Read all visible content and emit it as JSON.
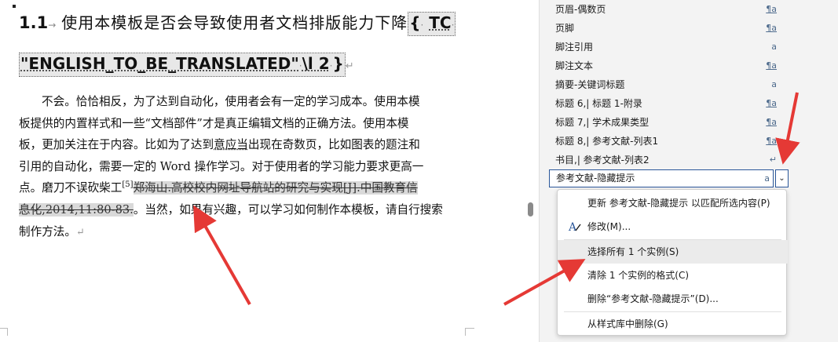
{
  "document": {
    "heading": {
      "number": "1.1",
      "title_cn": "使用本模板是否会导致使用者文档排版能力下降",
      "field_open": "{",
      "field_code": "TC",
      "field_arg": "\"ENGLISH_TO_BE_TRANSLATED\"",
      "field_switch": "\\l 2",
      "field_close": "}"
    },
    "paragraph": {
      "line1": "不会。恰恰相反，为了达到自动化，使用者会有一定的学习成本。使用本模",
      "line2": "板提供的内置样式和一些“文档部件”才是真正编辑文档的正确方法。使用本模",
      "line3_a": "板，更加关注在于内容。比如为了达到",
      "line3_u": "意应当",
      "line3_b": "出现在奇数页，比如图表的题注和",
      "line4": "引用的自动化，需要一定的 Word 操作学习。对于使用者的学习能力要求更高一",
      "line5_a": "点。磨刀不误砍柴工",
      "line5_sup": "[5]",
      "line5_strike": "郑海山.高校校内网址导航站的研究与实现[J].中国教育信",
      "line6_strike": "息化,2014,11:80-83.",
      "line6_b": "。当然，如果有兴趣，可以学习如何制作本模板，请自行搜索",
      "line7": "制作方法。",
      "para_mark": "↵"
    }
  },
  "styles_pane": {
    "items": [
      {
        "label": "页眉-偶数页",
        "tag": "¶a"
      },
      {
        "label": "页脚",
        "tag": "¶a"
      },
      {
        "label": "脚注引用",
        "tag": "a"
      },
      {
        "label": "脚注文本",
        "tag": "¶a"
      },
      {
        "label": "摘要-关键词标题",
        "tag": "a"
      },
      {
        "label": "标题 6,| 标题 1-附录",
        "tag": "¶a"
      },
      {
        "label": "标题 7,| 学术成果类型",
        "tag": "¶a"
      },
      {
        "label": "标题 8,| 参考文献-列表1",
        "tag": "¶a"
      },
      {
        "label": "书目,| 参考文献-列表2",
        "tag": "↵"
      }
    ],
    "selected": {
      "label": "参考文献-隐藏提示",
      "tag": "a",
      "dropdown_glyph": "⌄"
    }
  },
  "context_menu": {
    "update": "更新 参考文献-隐藏提示 以匹配所选内容(P)",
    "modify": "修改(M)...",
    "select_all": "选择所有 1 个实例(S)",
    "clear": "清除 1 个实例的格式(C)",
    "delete": "删除“参考文献-隐藏提示”(D)...",
    "remove_gallery": "从样式库中删除(G)"
  },
  "colors": {
    "arrow": "#e53935",
    "accent": "#2b579a",
    "highlight_row": "#ebebeb"
  }
}
